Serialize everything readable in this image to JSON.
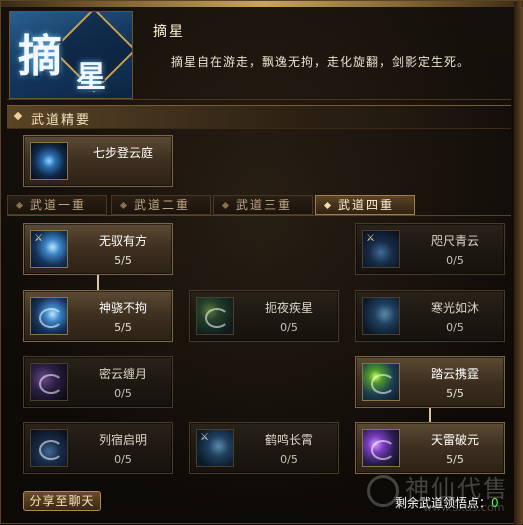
{
  "header": {
    "emblem_glyph_1": "摘",
    "emblem_glyph_2": "星",
    "skill_name": "摘星",
    "skill_description": "摘星自在游走，飘逸无拘，走化旋翻，剑影定生死。"
  },
  "section": {
    "title": "武道精要"
  },
  "featured": {
    "name": "七步登云庭",
    "icon": "meditating-figure-icon"
  },
  "tabs": [
    {
      "label": "武道一重",
      "active": false
    },
    {
      "label": "武道二重",
      "active": false
    },
    {
      "label": "武道三重",
      "active": false
    },
    {
      "label": "武道四重",
      "active": true
    }
  ],
  "skills": [
    {
      "name": "无驭有方",
      "level": "5/5",
      "icon": "sword-strike-icon",
      "learned": true
    },
    {
      "name": "咫尺青云",
      "level": "0/5",
      "icon": "night-figure-icon",
      "learned": false
    },
    {
      "name": "神骁不拘",
      "level": "5/5",
      "icon": "sword-strike-icon",
      "learned": true
    },
    {
      "name": "扼夜疾星",
      "level": "0/5",
      "icon": "starlight-icon",
      "learned": false
    },
    {
      "name": "寒光如沐",
      "level": "0/5",
      "icon": "sword-slash-icon",
      "learned": false
    },
    {
      "name": "密云缠月",
      "level": "0/5",
      "icon": "purple-swirl-icon",
      "learned": false
    },
    {
      "name": "踏云携霆",
      "level": "5/5",
      "icon": "green-swirl-icon",
      "learned": true
    },
    {
      "name": "列宿启明",
      "level": "0/5",
      "icon": "moon-swirl-icon",
      "learned": false
    },
    {
      "name": "鹤鸣长霄",
      "level": "0/5",
      "icon": "scroll-icon",
      "learned": false
    },
    {
      "name": "天雷破元",
      "level": "5/5",
      "icon": "thunder-figure-icon",
      "learned": true
    }
  ],
  "footer": {
    "share_button": "分享至聊天",
    "points_label": "剩余武道领悟点：",
    "points_value": "0"
  },
  "watermark": {
    "text": "神仙代售",
    "url": "www.sxds.com"
  },
  "colors": {
    "accent_gold": "#c9a45c",
    "points_green": "#4cff4c",
    "panel_brown": "#3d2f1f"
  }
}
